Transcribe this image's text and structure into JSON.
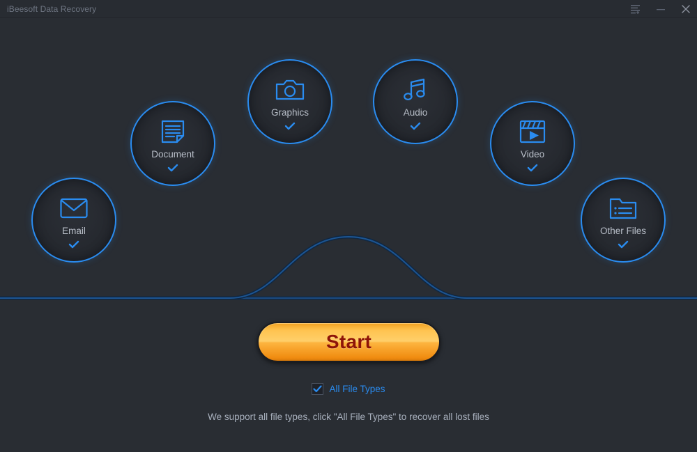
{
  "window": {
    "title": "iBeesoft Data Recovery",
    "controls": [
      {
        "name": "menu",
        "icon": "menu-list-icon",
        "label": "Menu"
      },
      {
        "name": "minimize",
        "icon": "minimize-icon",
        "label": "Minimize"
      },
      {
        "name": "close",
        "icon": "close-icon",
        "label": "Close"
      }
    ]
  },
  "colors": {
    "background": "#292d33",
    "titlebar": "#282c32",
    "accent_blue": "#2a8cf0",
    "circle_fill": "#24272d",
    "label_text": "#b9bfc9",
    "hint_text": "#a8b0bd",
    "start_gold": "#ffc451",
    "start_text_red": "#8e1408",
    "wave_line": "#1c4f8c"
  },
  "categories": [
    {
      "id": "graphics",
      "label": "Graphics",
      "icon": "camera-icon",
      "checked": true
    },
    {
      "id": "audio",
      "label": "Audio",
      "icon": "music-note-icon",
      "checked": true
    },
    {
      "id": "document",
      "label": "Document",
      "icon": "document-icon",
      "checked": true
    },
    {
      "id": "video",
      "label": "Video",
      "icon": "clapperboard-icon",
      "checked": true
    },
    {
      "id": "email",
      "label": "Email",
      "icon": "envelope-icon",
      "checked": true
    },
    {
      "id": "otherfiles",
      "label": "Other Files",
      "icon": "folder-list-icon",
      "checked": true
    }
  ],
  "start": {
    "label": "Start"
  },
  "all_file_types": {
    "label": "All File Types",
    "checked": true,
    "check_icon": "checkmark-icon"
  },
  "hint": {
    "text": "We support all file types, click \"All File Types\" to recover all lost files"
  }
}
